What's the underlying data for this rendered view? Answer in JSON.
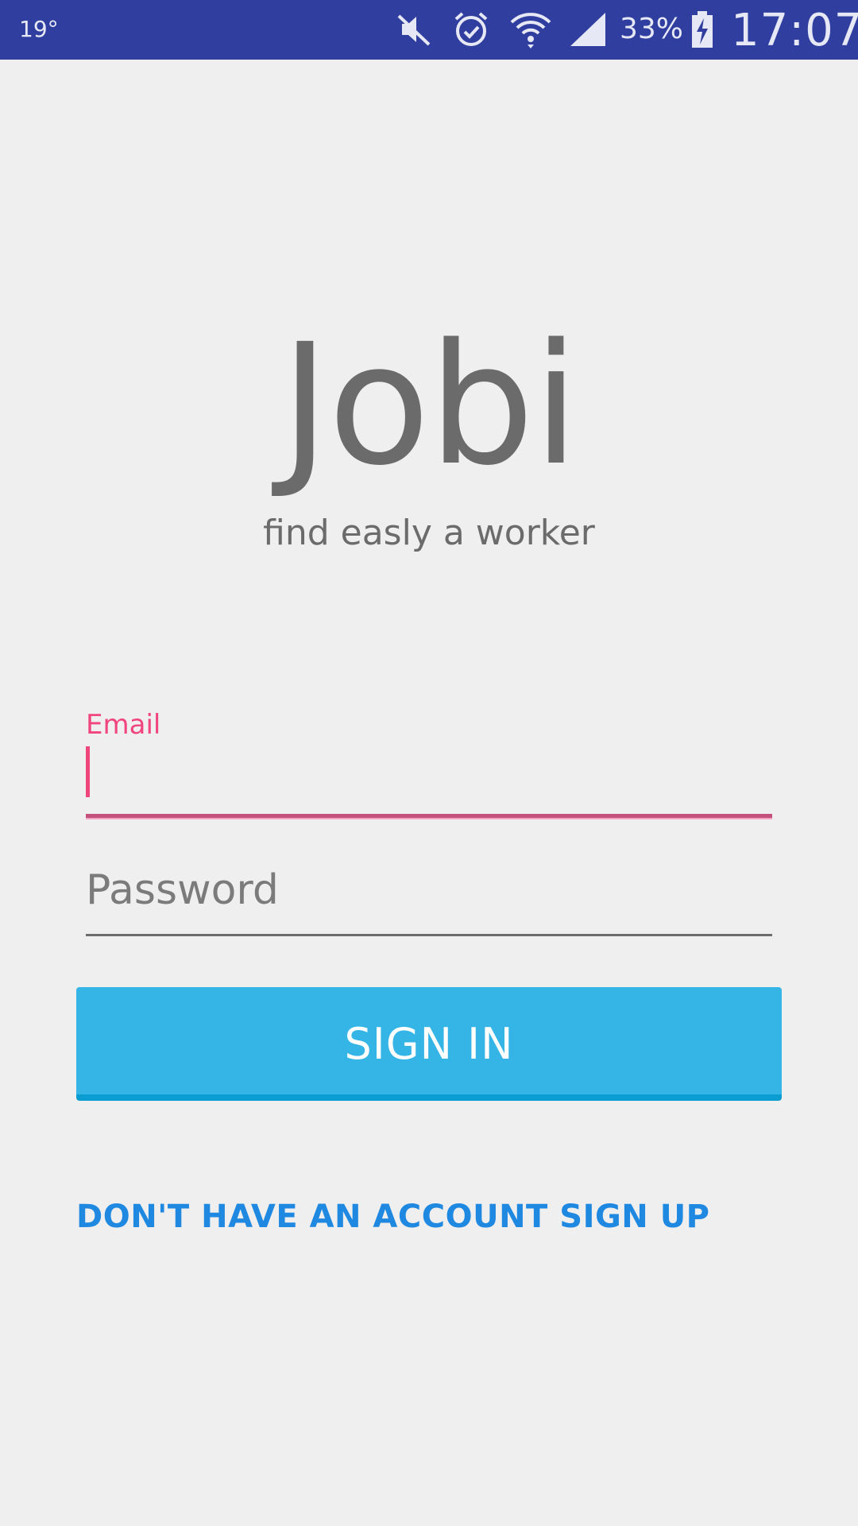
{
  "status_bar": {
    "temperature": "19°",
    "icons": [
      "mute-icon",
      "alarm-icon",
      "wifi-icon",
      "signal-icon",
      "battery-charging-icon"
    ],
    "battery_percent": "33%",
    "time": "17:07"
  },
  "app": {
    "title": "Jobi",
    "subtitle": "find easly a worker"
  },
  "form": {
    "email_label": "Email",
    "email_value": "",
    "password_placeholder": "Password",
    "signin_label": "SIGN IN"
  },
  "signup_link": "DON'T HAVE AN ACCOUNT SIGN UP",
  "colors": {
    "status_bar": "#303f9f",
    "accent": "#f0457d",
    "button": "#35b5e5",
    "link": "#1f88e0",
    "text_gray": "#6b6b6b"
  }
}
